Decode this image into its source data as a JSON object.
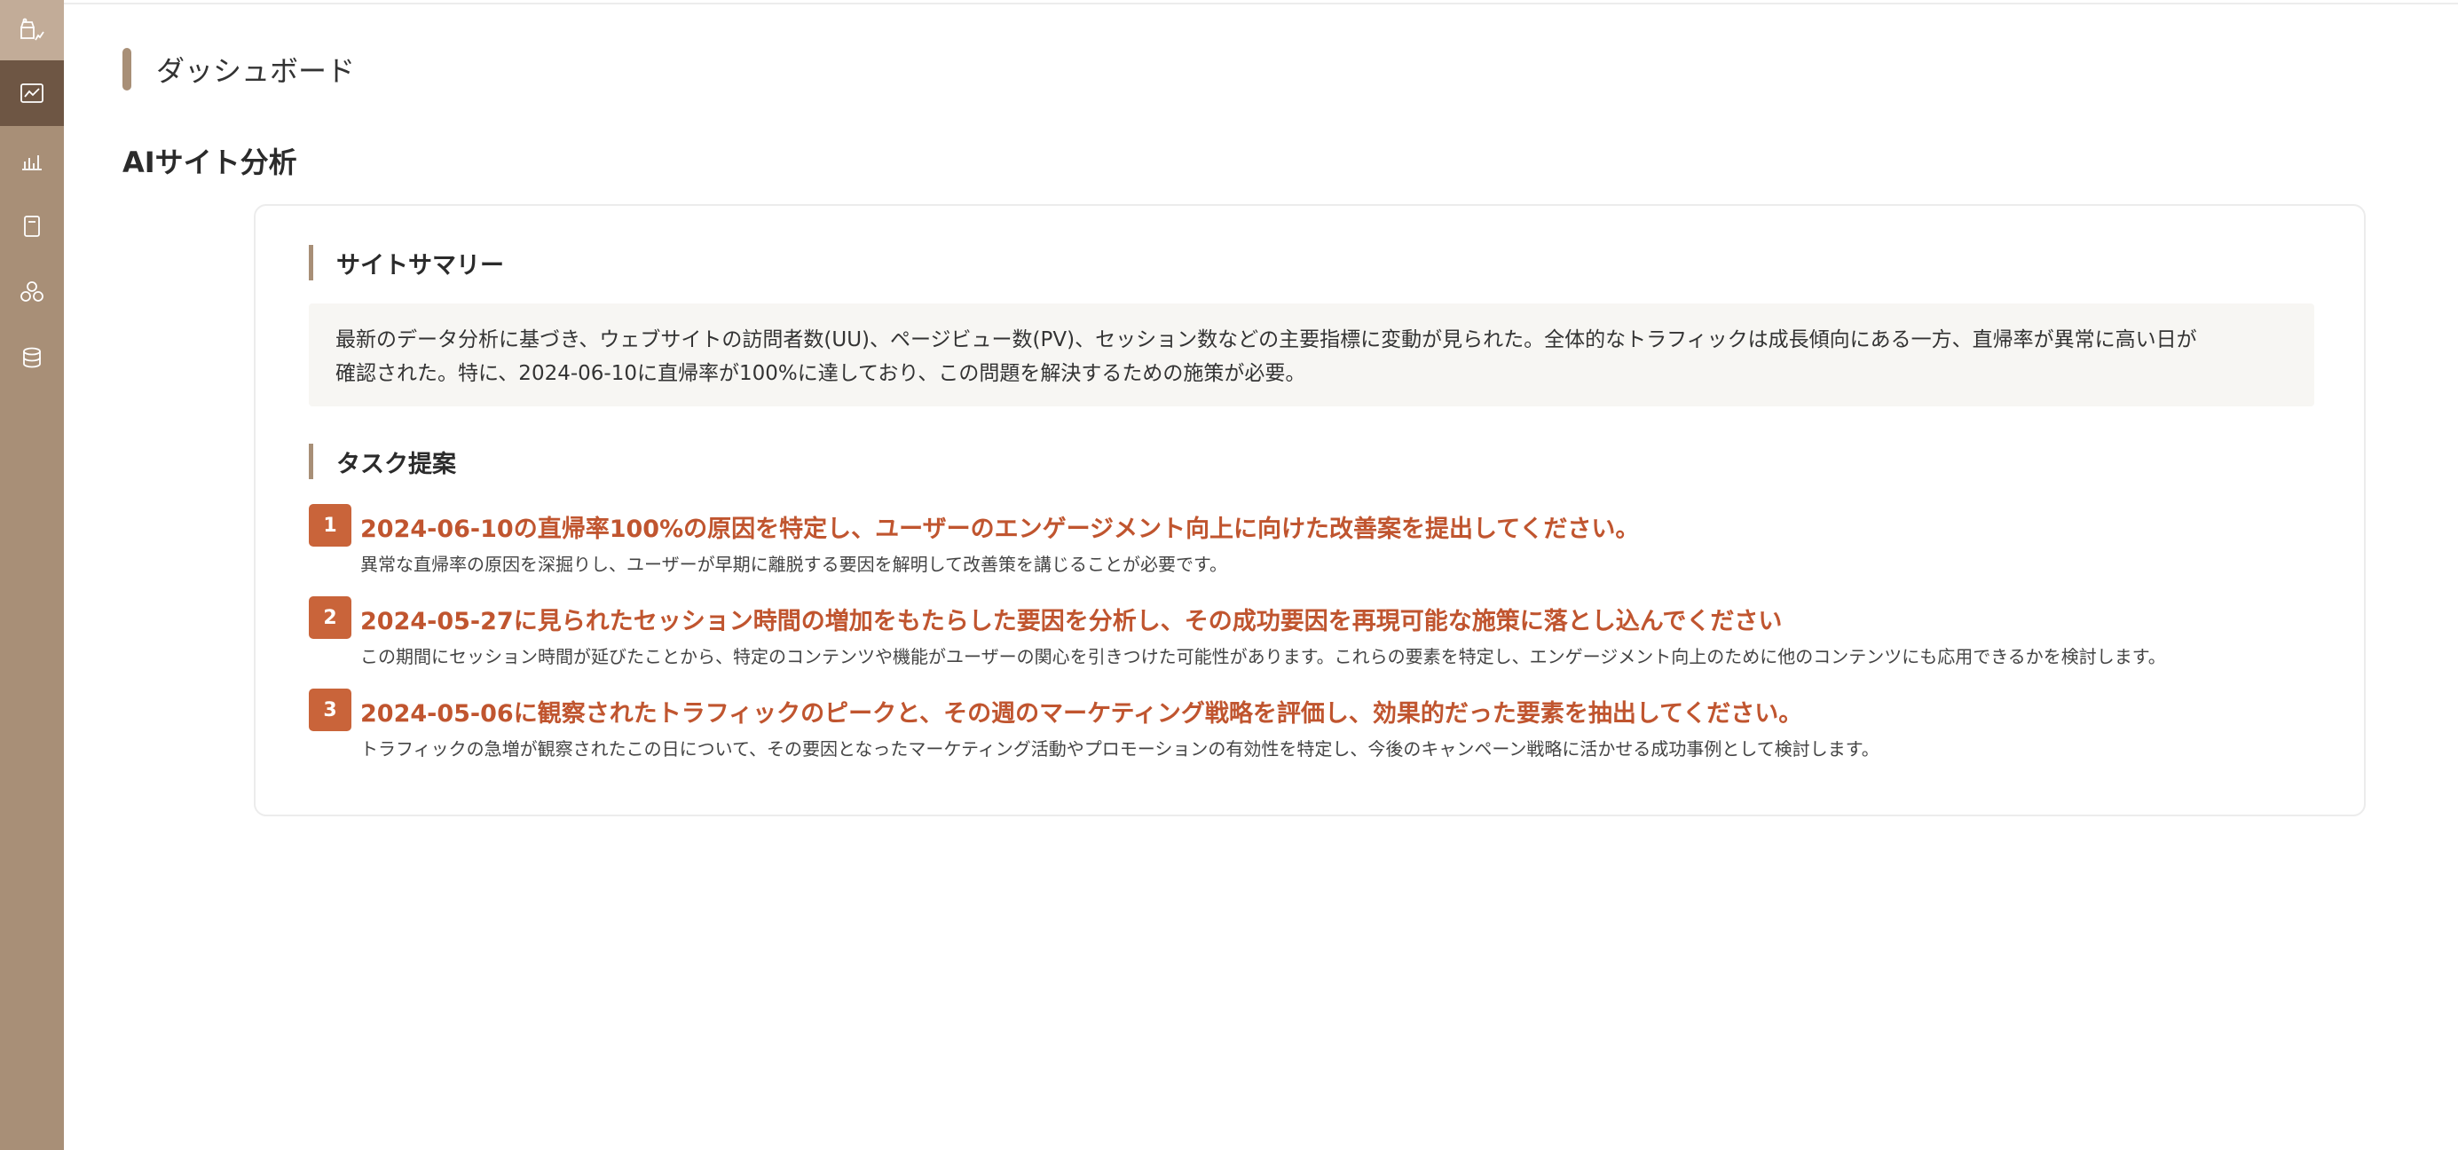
{
  "sidebar": {
    "logo_icon": "shop-chart-icon",
    "items": [
      {
        "icon": "line-chart-icon",
        "active": true
      },
      {
        "icon": "bar-chart-icon",
        "active": false
      },
      {
        "icon": "document-icon",
        "active": false
      },
      {
        "icon": "shapes-icon",
        "active": false
      },
      {
        "icon": "database-icon",
        "active": false
      }
    ]
  },
  "header": {
    "title": "ダッシュボード"
  },
  "main": {
    "section_title": "AIサイト分析",
    "summary": {
      "heading": "サイトサマリー",
      "line1": "最新のデータ分析に基づき、ウェブサイトの訪問者数(UU)、ページビュー数(PV)、セッション数などの主要指標に変動が見られた。全体的なトラフィックは成長傾向にある一方、直帰率が異常に高い日が",
      "line2": "確認された。特に、2024-06-10に直帰率が100%に達しており、この問題を解決するための施策が必要。"
    },
    "tasks": {
      "heading": "タスク提案",
      "items": [
        {
          "number": "1",
          "title": "2024-06-10の直帰率100%の原因を特定し、ユーザーのエンゲージメント向上に向けた改善案を提出してください。",
          "description": "異常な直帰率の原因を深掘りし、ユーザーが早期に離脱する要因を解明して改善策を講じることが必要です。"
        },
        {
          "number": "2",
          "title": "2024-05-27に見られたセッション時間の増加をもたらした要因を分析し、その成功要因を再現可能な施策に落とし込んでください",
          "description": "この期間にセッション時間が延びたことから、特定のコンテンツや機能がユーザーの関心を引きつけた可能性があります。これらの要素を特定し、エンゲージメント向上のために他のコンテンツにも応用できるかを検討します。"
        },
        {
          "number": "3",
          "title": "2024-05-06に観察されたトラフィックのピークと、その週のマーケティング戦略を評価し、効果的だった要素を抽出してください。",
          "description": "トラフィックの急増が観察されたこの日について、その要因となったマーケティング活動やプロモーションの有効性を特定し、今後のキャンペーン戦略に活かせる成功事例として検討します。"
        }
      ]
    }
  },
  "colors": {
    "sidebar": "#a88f77",
    "sidebar_active": "#6e5644",
    "accent": "#c9643a",
    "task_title": "#c0552f"
  }
}
